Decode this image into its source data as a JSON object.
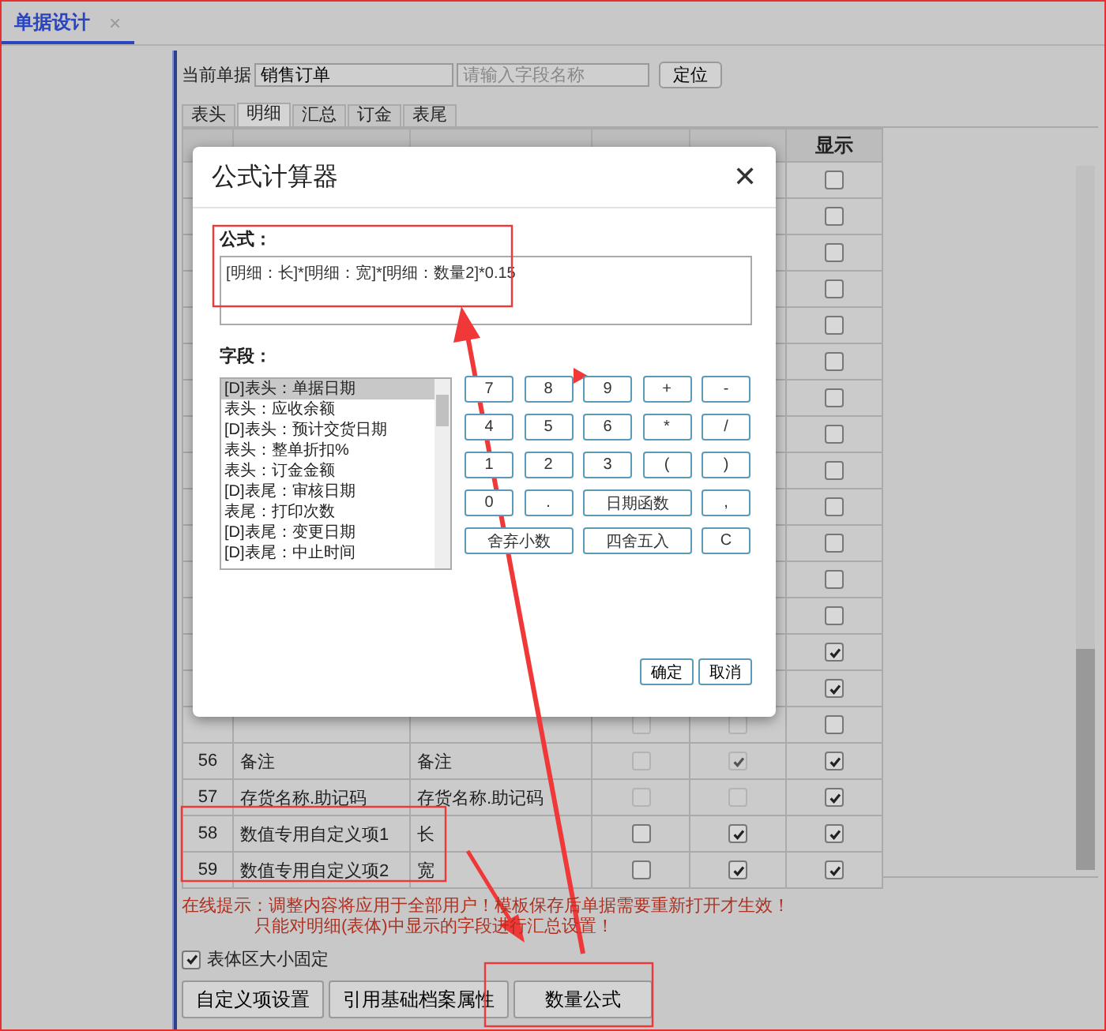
{
  "doc_tab": {
    "label": "单据设计",
    "close": "×",
    "selected": true
  },
  "toolbar": {
    "doc_label": "当前单据",
    "doc_value": "销售订单",
    "search_placeholder": "请输入字段名称",
    "locate_button": "定位"
  },
  "tabs": [
    {
      "label": "表头",
      "selected": false
    },
    {
      "label": "明细",
      "selected": true
    },
    {
      "label": "汇总",
      "selected": false
    },
    {
      "label": "订金",
      "selected": false
    },
    {
      "label": "表尾",
      "selected": false
    }
  ],
  "table": {
    "columns": [
      "显示"
    ],
    "rows": [
      {
        "shown": false
      },
      {
        "shown": false
      },
      {
        "shown": false
      },
      {
        "shown": false
      },
      {
        "shown": false
      },
      {
        "shown": false
      },
      {
        "shown": false
      },
      {
        "shown": false
      },
      {
        "shown": false
      },
      {
        "shown": false
      },
      {
        "shown": false
      },
      {
        "shown": false
      },
      {
        "shown": false
      },
      {
        "shown": true
      },
      {
        "shown": true
      },
      {
        "required": false,
        "editable": false,
        "shown": false,
        "disabled": true
      },
      {
        "no": "56",
        "field": "备注",
        "display": "备注",
        "required": false,
        "editable": true,
        "shown": true,
        "disabled": true
      },
      {
        "no": "57",
        "field": "存货名称.助记码",
        "display": "存货名称.助记码",
        "required": false,
        "editable": false,
        "shown": true,
        "disabled": true
      },
      {
        "no": "58",
        "field": "数值专用自定义项1",
        "display": "长",
        "required": false,
        "editable": true,
        "shown": true,
        "disabled": false
      },
      {
        "no": "59",
        "field": "数值专用自定义项2",
        "display": "宽",
        "required": false,
        "editable": true,
        "shown": true,
        "disabled": false
      }
    ]
  },
  "dialog": {
    "title": "公式计算器",
    "close": "✕",
    "formula_label": "公式：",
    "formula": "[明细：长]*[明细：宽]*[明细：数量2]*0.15",
    "fields_label": "字段：",
    "fields": [
      {
        "label": "[D]表头：单据日期",
        "selected": true
      },
      {
        "label": "表头：应收余额",
        "selected": false
      },
      {
        "label": "[D]表头：预计交货日期",
        "selected": false
      },
      {
        "label": "表头：整单折扣%",
        "selected": false
      },
      {
        "label": "表头：订金金额",
        "selected": false
      },
      {
        "label": "[D]表尾：审核日期",
        "selected": false
      },
      {
        "label": "表尾：打印次数",
        "selected": false
      },
      {
        "label": "[D]表尾：变更日期",
        "selected": false
      },
      {
        "label": "[D]表尾：中止时间",
        "selected": false
      }
    ],
    "keys": [
      {
        "label": "7",
        "kind": "key"
      },
      {
        "label": "8",
        "kind": "key"
      },
      {
        "label": "9",
        "kind": "key"
      },
      {
        "label": "+",
        "kind": "key"
      },
      {
        "label": "-",
        "kind": "key"
      },
      {
        "label": "4",
        "kind": "key"
      },
      {
        "label": "5",
        "kind": "key"
      },
      {
        "label": "6",
        "kind": "key"
      },
      {
        "label": "*",
        "kind": "key"
      },
      {
        "label": "/",
        "kind": "key"
      },
      {
        "label": "1",
        "kind": "key"
      },
      {
        "label": "2",
        "kind": "key"
      },
      {
        "label": "3",
        "kind": "key"
      },
      {
        "label": "(",
        "kind": "key"
      },
      {
        "label": ")",
        "kind": "key"
      },
      {
        "label": "0",
        "kind": "key"
      },
      {
        "label": ".",
        "kind": "key"
      },
      {
        "label": "日期函数",
        "kind": "wide"
      },
      {
        "label": ",",
        "kind": "key"
      },
      {
        "label": "舍弃小数",
        "kind": "wide"
      },
      {
        "label": "四舍五入",
        "kind": "wide"
      },
      {
        "label": "C",
        "kind": "key"
      }
    ],
    "buttons": [
      "确定",
      "取消"
    ]
  },
  "notice": [
    "在线提示：调整内容将应用于全部用户！模板保存后单据需要重新打开才生效！",
    "只能对明细(表体)中显示的字段进行汇总设置！"
  ],
  "fixed_size": {
    "label": "表体区大小固定",
    "checked": true
  },
  "buttons": [
    "自定义项设置",
    "引用基础档案属性",
    "数量公式"
  ]
}
